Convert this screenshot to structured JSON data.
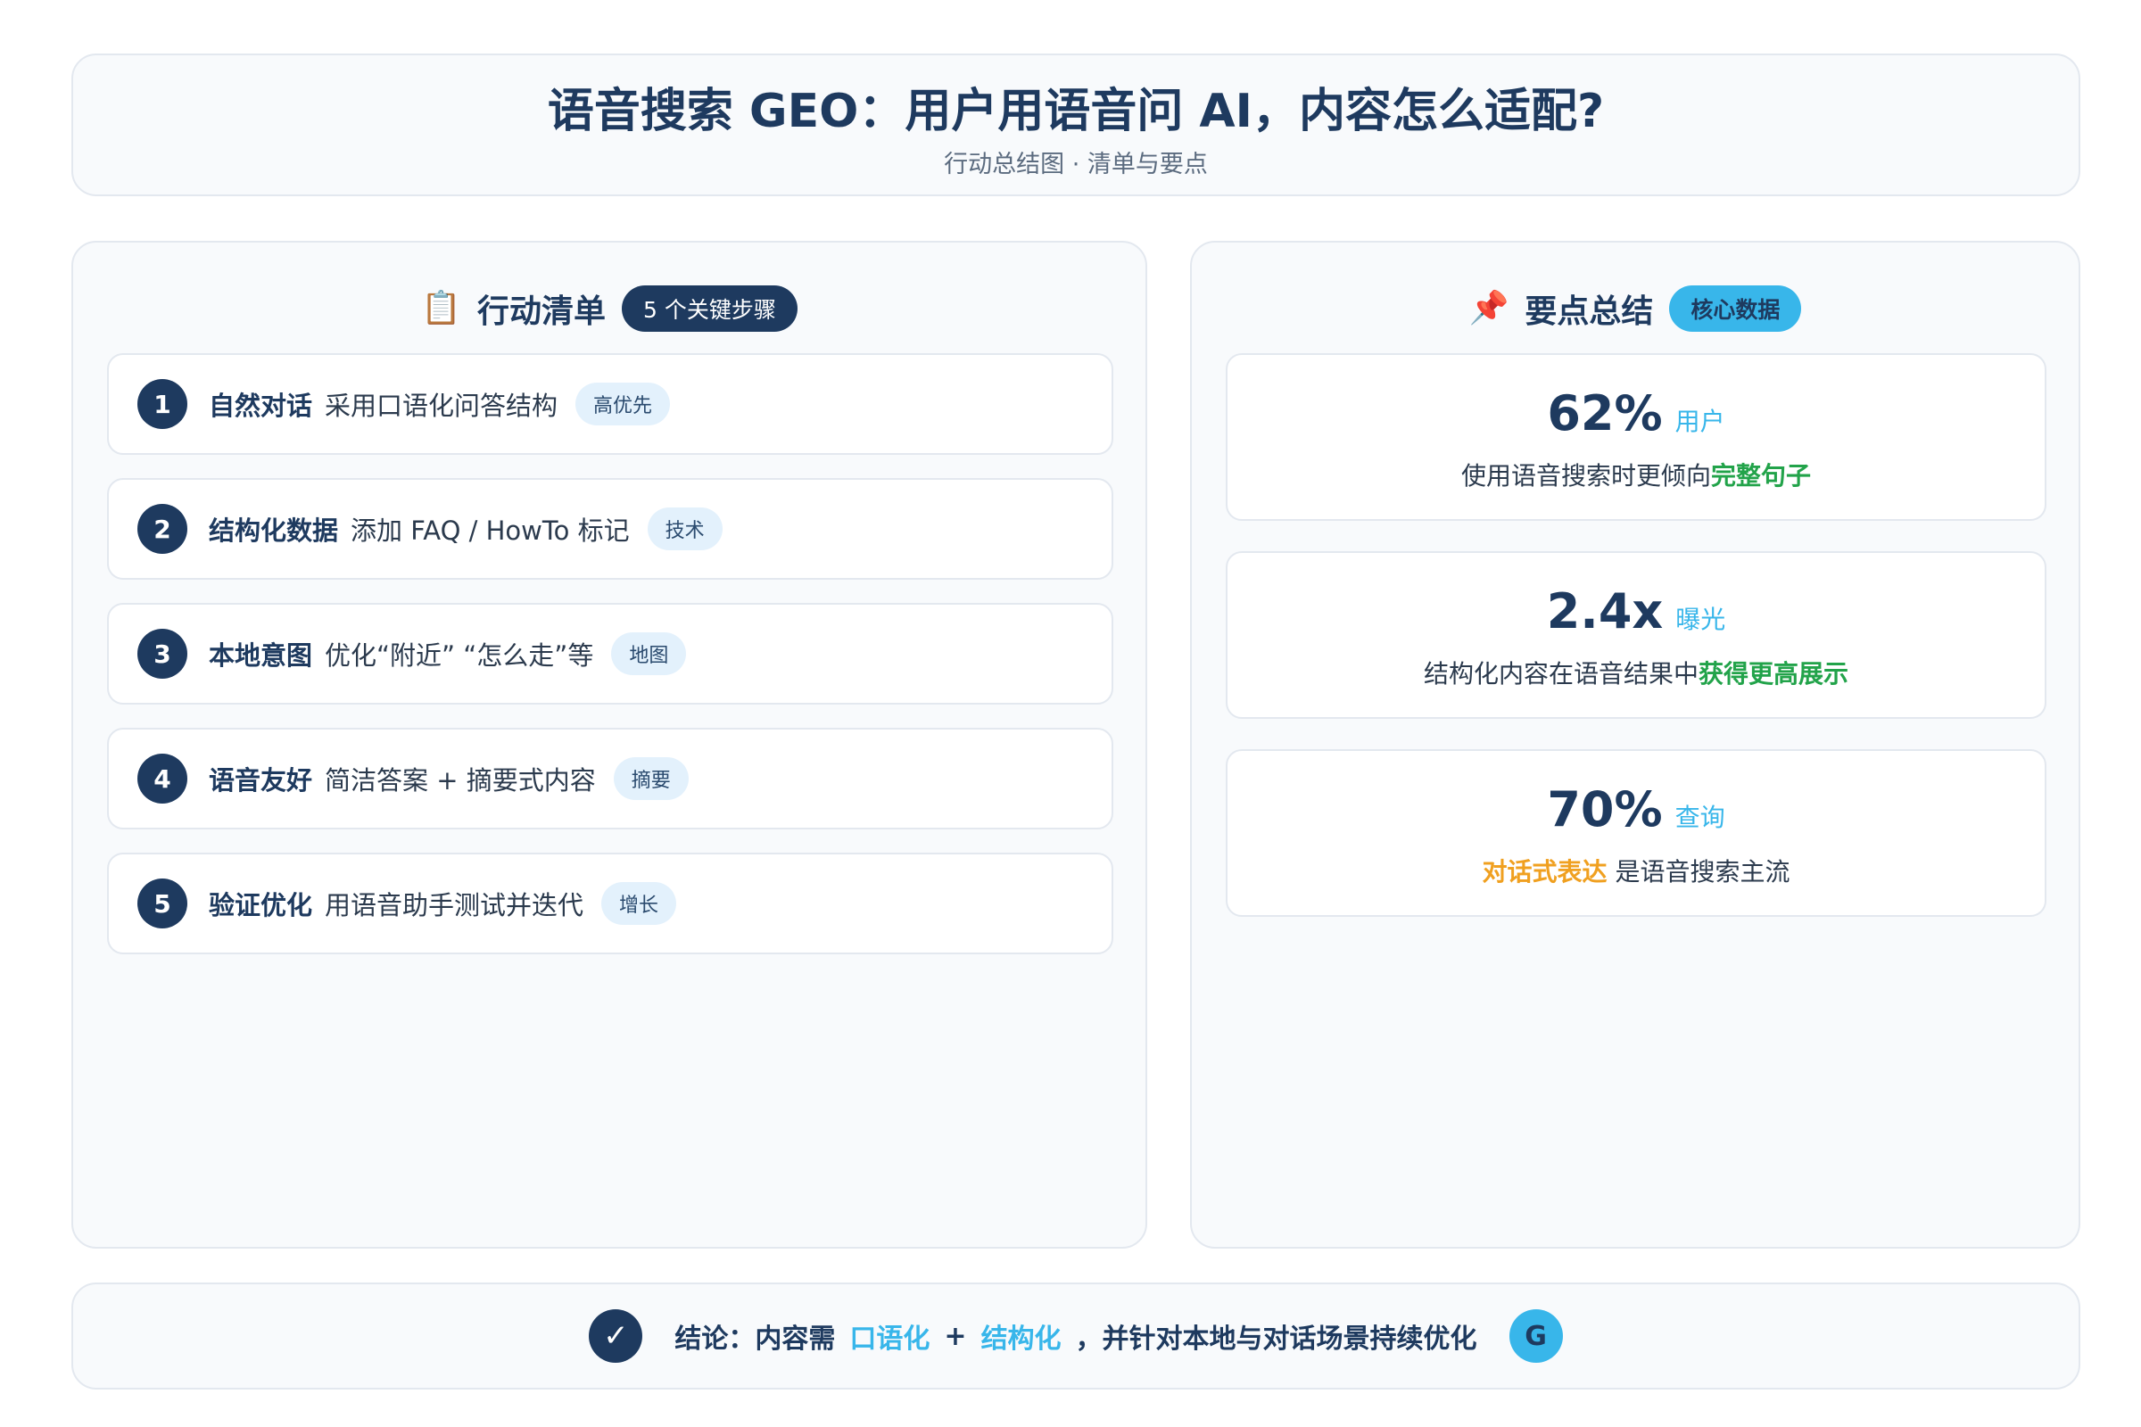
{
  "header": {
    "title": "语音搜索 GEO：用户用语音问 AI，内容怎么适配?",
    "subtitle": "行动总结图 · 清单与要点"
  },
  "action_list": {
    "icon": "clipboard-icon",
    "icon_glyph": "📋",
    "title": "行动清单",
    "badge": "5 个关键步骤",
    "steps": [
      {
        "num": "1",
        "title": "自然对话",
        "desc": "采用口语化问答结构",
        "tag": "高优先"
      },
      {
        "num": "2",
        "title": "结构化数据",
        "desc": "添加 FAQ / HowTo 标记",
        "tag": "技术"
      },
      {
        "num": "3",
        "title": "本地意图",
        "desc": "优化“附近” “怎么走”等",
        "tag": "地图"
      },
      {
        "num": "4",
        "title": "语音友好",
        "desc": "简洁答案 + 摘要式内容",
        "tag": "摘要"
      },
      {
        "num": "5",
        "title": "验证优化",
        "desc": "用语音助手测试并迭代",
        "tag": "增长"
      }
    ]
  },
  "key_points": {
    "icon": "pushpin-icon",
    "icon_glyph": "📌",
    "title": "要点总结",
    "badge": "核心数据",
    "stats": [
      {
        "value": "62%",
        "unit": "用户",
        "desc_before": "使用语音搜索时更倾向",
        "desc_highlight": "完整句子",
        "desc_after": ""
      },
      {
        "value": "2.4x",
        "unit": "曝光",
        "desc_before": "结构化内容在语音结果中",
        "desc_highlight": "获得更高展示",
        "desc_after": ""
      },
      {
        "value": "70%",
        "unit": "查询",
        "desc_before": "",
        "desc_highlight": "对话式表达",
        "desc_after": " 是语音搜索主流"
      }
    ]
  },
  "footer": {
    "check_glyph": "✓",
    "prefix": "结论：内容需",
    "hl1": "口语化",
    "plus": "+",
    "hl2": "结构化",
    "suffix": "，并针对本地与对话场景持续优化",
    "badge_letter": "G"
  },
  "colors": {
    "navy": "#1e3a5f",
    "accent_blue": "#38b6ea",
    "green": "#22a34a",
    "orange": "#f0a020"
  }
}
